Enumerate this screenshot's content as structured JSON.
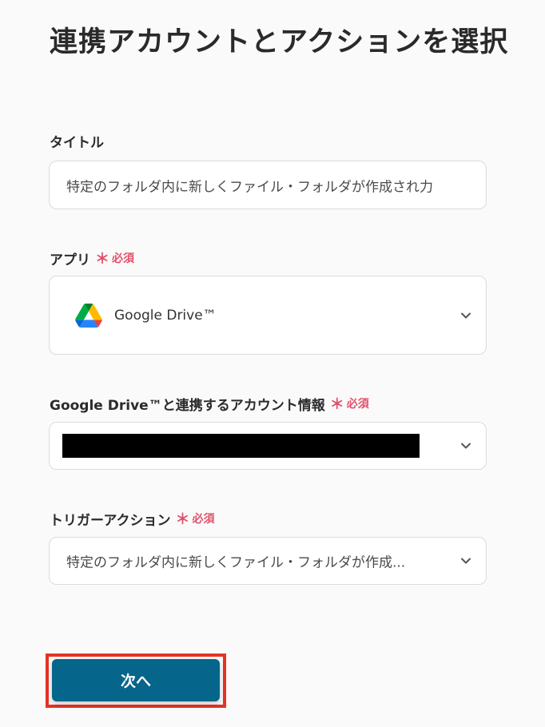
{
  "page": {
    "title": "連携アカウントとアクションを選択"
  },
  "form": {
    "title_field": {
      "label": "タイトル",
      "value": "特定のフォルダ内に新しくファイル・フォルダが作成され力"
    },
    "app_field": {
      "label": "アプリ",
      "required_mark": "＊",
      "required_text": "必須",
      "value": "Google Drive™",
      "icon": "google-drive-icon"
    },
    "account_field": {
      "label": "Google Drive™と連携するアカウント情報",
      "required_mark": "＊",
      "required_text": "必須",
      "value_redacted": true
    },
    "trigger_field": {
      "label": "トリガーアクション",
      "required_mark": "＊",
      "required_text": "必須",
      "value": "特定のフォルダ内に新しくファイル・フォルダが作成..."
    }
  },
  "actions": {
    "next_label": "次へ"
  },
  "colors": {
    "primary": "#06658a",
    "required": "#e0526a",
    "highlight_outline": "#e53323"
  }
}
